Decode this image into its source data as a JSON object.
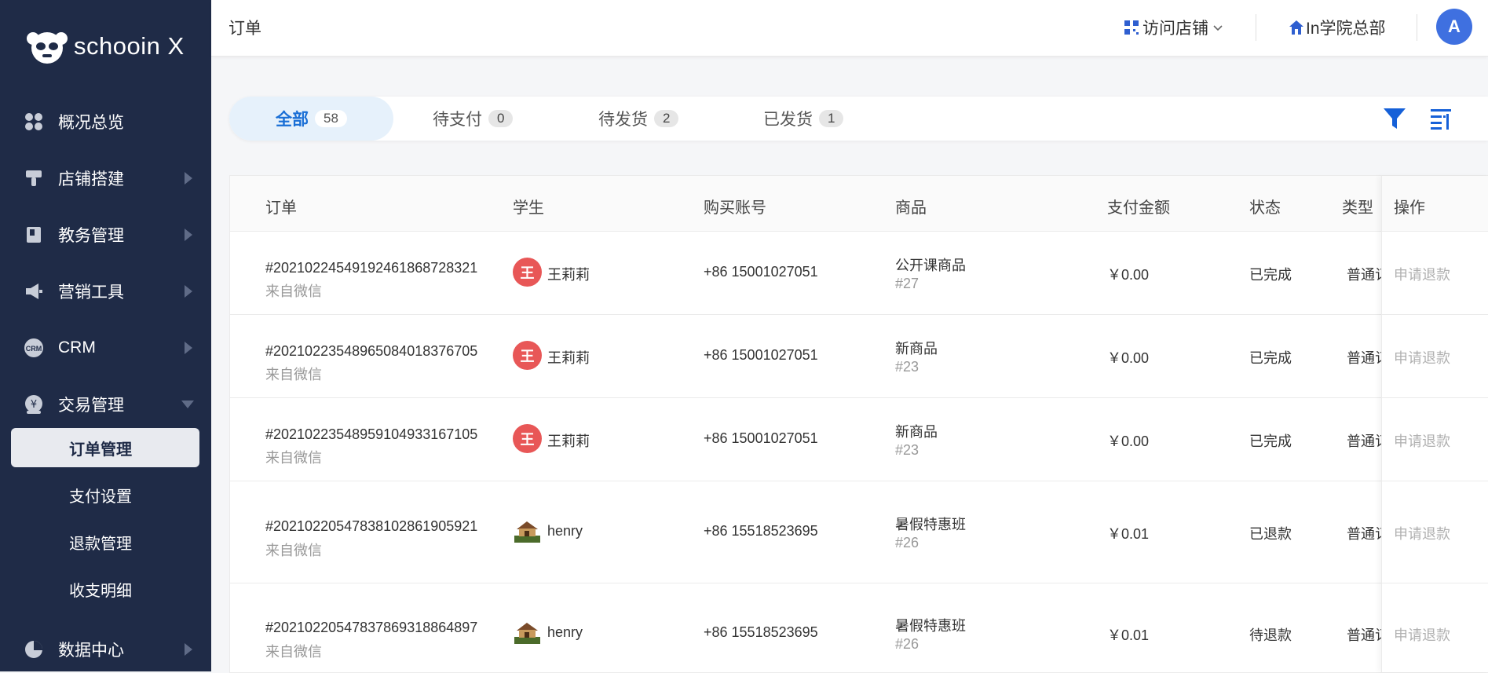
{
  "brand": {
    "name": "schooin X"
  },
  "sidebar": {
    "items": [
      {
        "label": "概况总览",
        "icon": "dashboard-icon",
        "arrow": "none"
      },
      {
        "label": "店铺搭建",
        "icon": "brush-icon",
        "arrow": "right"
      },
      {
        "label": "教务管理",
        "icon": "book-icon",
        "arrow": "right"
      },
      {
        "label": "营销工具",
        "icon": "megaphone-icon",
        "arrow": "right"
      },
      {
        "label": "CRM",
        "icon": "crm-icon",
        "arrow": "right"
      },
      {
        "label": "交易管理",
        "icon": "yen-icon",
        "arrow": "down"
      },
      {
        "label": "数据中心",
        "icon": "pie-chart-icon",
        "arrow": "right"
      }
    ],
    "sub_items": [
      {
        "label": "订单管理",
        "active": true
      },
      {
        "label": "支付设置",
        "active": false
      },
      {
        "label": "退款管理",
        "active": false
      },
      {
        "label": "收支明细",
        "active": false
      }
    ]
  },
  "topbar": {
    "title": "订单",
    "visit_shop": "访问店铺",
    "org": "In学院总部",
    "avatar": "A"
  },
  "tabs": [
    {
      "label": "全部",
      "count": "58",
      "active": true
    },
    {
      "label": "待支付",
      "count": "0",
      "active": false
    },
    {
      "label": "待发货",
      "count": "2",
      "active": false
    },
    {
      "label": "已发货",
      "count": "1",
      "active": false
    }
  ],
  "table": {
    "headers": {
      "order": "订单",
      "student": "学生",
      "account": "购买账号",
      "product": "商品",
      "amount": "支付金额",
      "status": "状态",
      "type": "类型",
      "action": "操作"
    },
    "rows": [
      {
        "order_no": "#20210224549192461868728321",
        "source": "来自微信",
        "student": "王莉莉",
        "avatar_text": "王",
        "avatar_kind": "letter",
        "account": "+86 15001027051",
        "product": "公开课商品",
        "product_id": "#27",
        "amount": "￥0.00",
        "status": "已完成",
        "type": "普通订",
        "action": "申请退款"
      },
      {
        "order_no": "#20210223548965084018376705",
        "source": "来自微信",
        "student": "王莉莉",
        "avatar_text": "王",
        "avatar_kind": "letter",
        "account": "+86 15001027051",
        "product": "新商品",
        "product_id": "#23",
        "amount": "￥0.00",
        "status": "已完成",
        "type": "普通订",
        "action": "申请退款"
      },
      {
        "order_no": "#20210223548959104933167105",
        "source": "来自微信",
        "student": "王莉莉",
        "avatar_text": "王",
        "avatar_kind": "letter",
        "account": "+86 15001027051",
        "product": "新商品",
        "product_id": "#23",
        "amount": "￥0.00",
        "status": "已完成",
        "type": "普通订",
        "action": "申请退款"
      },
      {
        "order_no": "#20210220547838102861905921",
        "source": "来自微信",
        "student": "henry",
        "avatar_text": "",
        "avatar_kind": "image",
        "account": "+86 15518523695",
        "product": "暑假特惠班",
        "product_id": "#26",
        "amount": "￥0.01",
        "status": "已退款",
        "type": "普通订",
        "action": "申请退款"
      },
      {
        "order_no": "#20210220547837869318864897",
        "source": "来自微信",
        "student": "henry",
        "avatar_text": "",
        "avatar_kind": "image",
        "account": "+86 15518523695",
        "product": "暑假特惠班",
        "product_id": "#26",
        "amount": "￥0.01",
        "status": "待退款",
        "type": "普通订",
        "action": "申请退款"
      }
    ]
  }
}
